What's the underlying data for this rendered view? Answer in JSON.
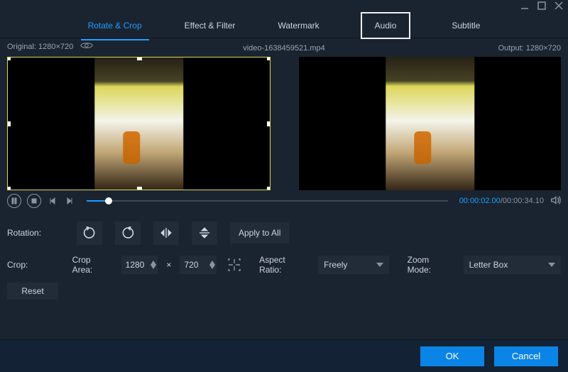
{
  "titlebar": {
    "minimize": "minimize",
    "maximize": "maximize",
    "close": "close"
  },
  "tabs": {
    "items": [
      {
        "label": "Rotate & Crop",
        "active": true
      },
      {
        "label": "Effect & Filter"
      },
      {
        "label": "Watermark"
      },
      {
        "label": "Audio",
        "highlight": true
      },
      {
        "label": "Subtitle"
      }
    ]
  },
  "info": {
    "original_label": "Original: 1280×720",
    "filename": "video-1638459521.mp4",
    "output_label": "Output: 1280×720"
  },
  "playbar": {
    "current_time": "00:00:02.00",
    "total_time": "00:00:34.10",
    "separator": "/"
  },
  "rotation": {
    "label": "Rotation:",
    "apply_label": "Apply to All",
    "icons": [
      "rotate-ccw-icon",
      "rotate-cw-icon",
      "flip-horizontal-icon",
      "flip-vertical-icon"
    ]
  },
  "crop": {
    "label": "Crop:",
    "area_label": "Crop Area:",
    "width": "1280",
    "height": "720",
    "times": "×",
    "aspect_label": "Aspect Ratio:",
    "aspect_value": "Freely",
    "zoom_label": "Zoom Mode:",
    "zoom_value": "Letter Box",
    "reset_label": "Reset"
  },
  "footer": {
    "ok": "OK",
    "cancel": "Cancel"
  }
}
